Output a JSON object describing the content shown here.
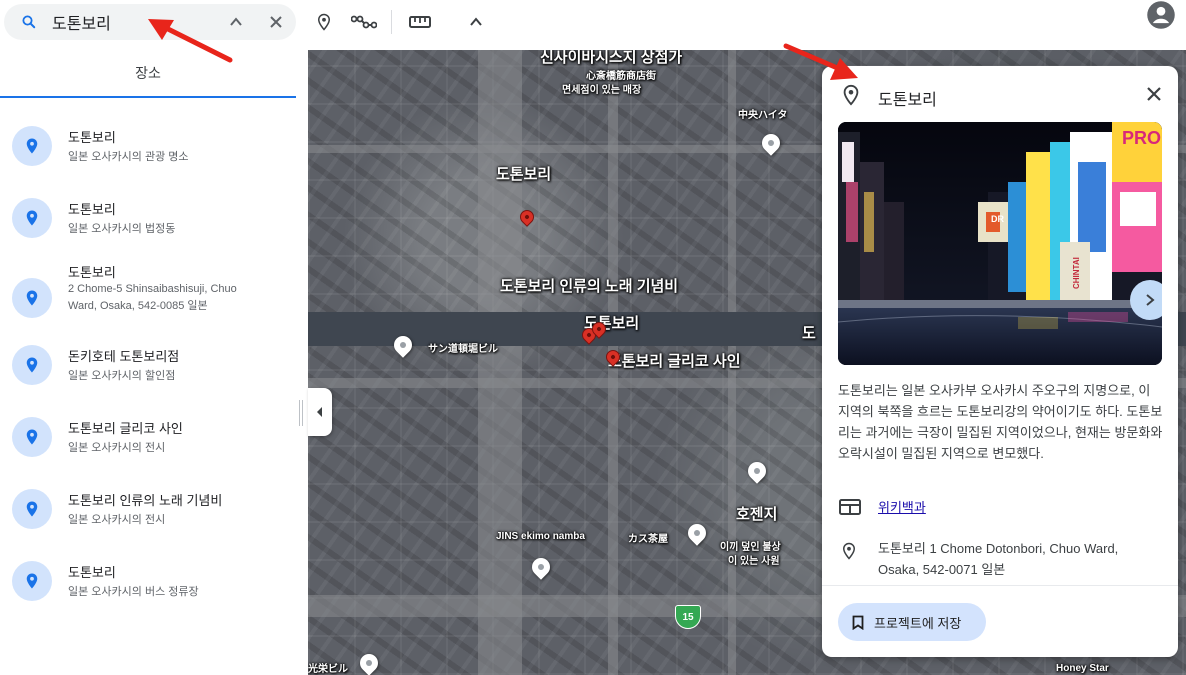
{
  "search": {
    "value": "도톤보리"
  },
  "tabs": {
    "places": "장소"
  },
  "results": [
    {
      "title": "도톤보리",
      "subtitle": "일본 오사카시의 관광 명소"
    },
    {
      "title": "도톤보리",
      "subtitle": "일본 오사카시의 법정동"
    },
    {
      "title": "도톤보리",
      "subtitle": "2 Chome-5 Shinsaibashisuji, Chuo Ward, Osaka, 542-0085 일본"
    },
    {
      "title": "돈키호테 도톤보리점",
      "subtitle": "일본 오사카시의 할인점"
    },
    {
      "title": "도톤보리 글리코 사인",
      "subtitle": "일본 오사카시의 전시"
    },
    {
      "title": "도톤보리 인류의 노래 기념비",
      "subtitle": "일본 오사카시의 전시"
    },
    {
      "title": "도톤보리",
      "subtitle": "일본 오사카시의 버스 정류장"
    }
  ],
  "map": {
    "labels": [
      "신사이바시스지 상점가",
      "心斎橋筋商店街",
      "면세점이 있는 매장",
      "中央ハイタ",
      "도톤보리",
      "도톤보리 인류의 노래 기념비",
      "도톤보리",
      "도톤보리 글리코 사인",
      "도",
      "サン道頓堀ビル",
      "호젠지",
      "이끼 덮인 불상",
      "이 있는 사원",
      "JINS ekimo namba",
      "カス茶屋",
      "Honey Star",
      "光栄ビル"
    ],
    "route_badge": "15"
  },
  "card": {
    "title": "도톤보리",
    "description": "도톤보리는 일본 오사카부 오사카시 주오구의 지명으로, 이 지역의 북쪽을 흐르는 도톤보리강의 약어이기도 하다. 도톤보리는 과거에는 극장이 밀집된 지역이었으나, 현재는 방문화와 오락시설이 밀집된 지역으로 변모했다.",
    "wiki_label": "위키백과",
    "address": "도톤보리 1 Chome Dotonbori, Chuo Ward, Osaka, 542-0071 일본",
    "save_label": "프로젝트에 저장",
    "photo_signs": [
      "PRO",
      "DR",
      "CHINTAI"
    ]
  },
  "colors": {
    "accent": "#1a73e8",
    "annotation_arrow": "#e8251b",
    "save_button_bg": "#d3e3fd",
    "result_icon_bg": "#d2e3fc"
  }
}
